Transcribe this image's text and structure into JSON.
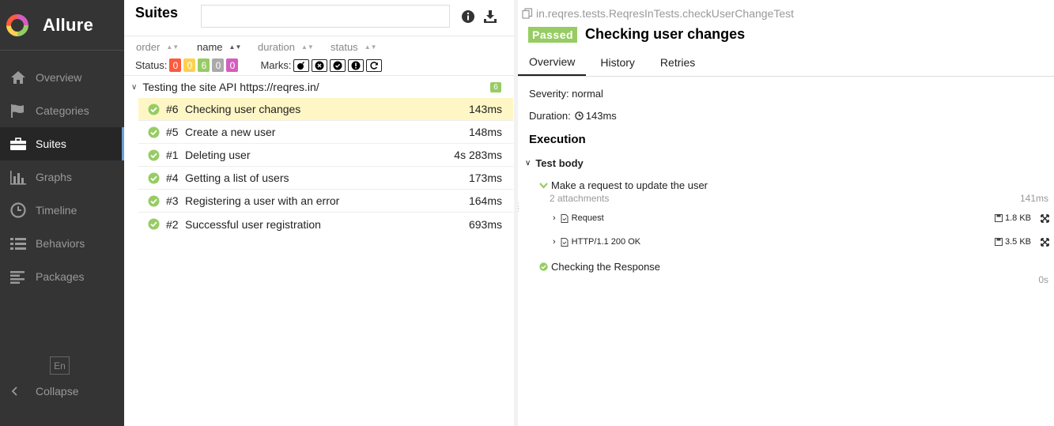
{
  "app": {
    "name": "Allure"
  },
  "sidebar": {
    "items": [
      {
        "label": "Overview",
        "icon": "home-icon"
      },
      {
        "label": "Categories",
        "icon": "flag-icon"
      },
      {
        "label": "Suites",
        "icon": "briefcase-icon"
      },
      {
        "label": "Graphs",
        "icon": "bar-chart-icon"
      },
      {
        "label": "Timeline",
        "icon": "clock-icon"
      },
      {
        "label": "Behaviors",
        "icon": "list-icon"
      },
      {
        "label": "Packages",
        "icon": "align-left-icon"
      }
    ],
    "active": "Suites",
    "language": "En",
    "collapse_label": "Collapse"
  },
  "suites": {
    "title": "Suites",
    "search": {
      "value": "",
      "placeholder": ""
    },
    "sorters": [
      "order",
      "name",
      "duration",
      "status"
    ],
    "active_sorter": "name",
    "status_label": "Status:",
    "status_counts": [
      {
        "value": "0",
        "color": "#fd5a3e",
        "status": "failed"
      },
      {
        "value": "0",
        "color": "#ffd050",
        "status": "broken"
      },
      {
        "value": "6",
        "color": "#97cc64",
        "status": "passed"
      },
      {
        "value": "0",
        "color": "#aaaaaa",
        "status": "skipped"
      },
      {
        "value": "0",
        "color": "#d35ebe",
        "status": "unknown"
      }
    ],
    "marks_label": "Marks:",
    "marks": [
      "bomb-icon",
      "times-circle-icon",
      "check-circle-icon",
      "exclamation-icon",
      "refresh-icon"
    ],
    "group": {
      "name": "Testing the site API https://reqres.in/",
      "count": "6"
    },
    "tests": [
      {
        "num": "#6",
        "name": "Checking user changes",
        "duration": "143ms",
        "selected": true
      },
      {
        "num": "#5",
        "name": "Create a new user",
        "duration": "148ms"
      },
      {
        "num": "#1",
        "name": "Deleting user",
        "duration": "4s 283ms"
      },
      {
        "num": "#4",
        "name": "Getting a list of users",
        "duration": "173ms"
      },
      {
        "num": "#3",
        "name": "Registering a user with an error",
        "duration": "164ms"
      },
      {
        "num": "#2",
        "name": "Successful user registration",
        "duration": "693ms"
      }
    ]
  },
  "result": {
    "full_name": "in.reqres.tests.ReqresInTests.checkUserChangeTest",
    "status": "Passed",
    "title": "Checking user changes",
    "tabs": [
      "Overview",
      "History",
      "Retries"
    ],
    "active_tab": "Overview",
    "severity": "Severity: normal",
    "duration_label": "Duration:",
    "duration": "143ms",
    "execution_title": "Execution",
    "test_body": "Test body",
    "steps": [
      {
        "name": "Make a request to update the user",
        "attachments_label": "2 attachments",
        "duration": "141ms",
        "attachments": [
          {
            "name": "Request",
            "size": "1.8 KB"
          },
          {
            "name": "HTTP/1.1 200 OK",
            "size": "3.5 KB"
          }
        ]
      },
      {
        "name": "Checking the Response",
        "duration": "0s"
      }
    ]
  },
  "colors": {
    "passed": "#97cc64",
    "sidebar_bg": "#343434",
    "selected_row": "#fff6c6",
    "active_nav_accent": "#6a9fd8"
  }
}
